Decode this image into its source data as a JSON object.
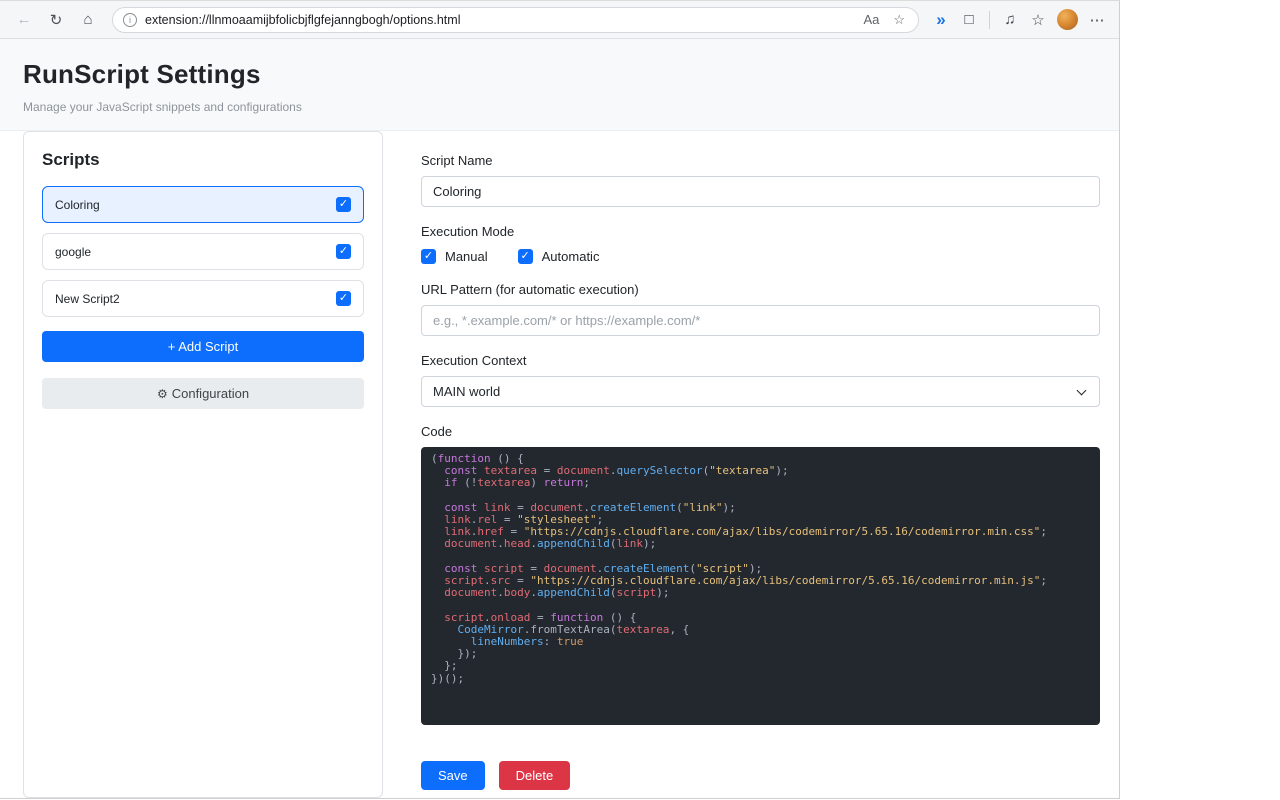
{
  "colors": {
    "accent": "#0d6efd",
    "danger": "#dc3545",
    "selected_bg": "#e7f1ff",
    "code_bg": "#23272e",
    "tok_plain": "#abb2bf",
    "tok_keyword": "#c678dd",
    "tok_variable": "#e06c75",
    "tok_function": "#61afef",
    "tok_string": "#e5c07b",
    "tok_literal": "#d19a66"
  },
  "browser": {
    "url": "extension://llnmoaamijbfolicbjflgfejanngbogh/options.html",
    "icons": {
      "back": "←",
      "refresh": "↻",
      "home": "⌂",
      "info": "i",
      "translate": "Aa",
      "favorite": "☆",
      "sidebar": "»",
      "collections": "□",
      "ext1": "♫",
      "ext2": "☆",
      "menu": "⋯"
    }
  },
  "page": {
    "title": "RunScript Settings",
    "subtitle": "Manage your JavaScript snippets and configurations"
  },
  "sidebar": {
    "heading": "Scripts",
    "scripts": [
      {
        "name": "Coloring",
        "checked": true,
        "selected": true
      },
      {
        "name": "google",
        "checked": true,
        "selected": false
      },
      {
        "name": "New Script2",
        "checked": true,
        "selected": false
      }
    ],
    "add_button": "+ Add Script",
    "config_icon": "⚙",
    "config_label": "Configuration"
  },
  "form": {
    "script_name": {
      "label": "Script Name",
      "value": "Coloring"
    },
    "execution_mode": {
      "label": "Execution Mode",
      "options": [
        {
          "label": "Manual",
          "checked": true
        },
        {
          "label": "Automatic",
          "checked": true
        }
      ]
    },
    "url_pattern": {
      "label": "URL Pattern (for automatic execution)",
      "value": "",
      "placeholder": "e.g., *.example.com/* or https://example.com/*"
    },
    "execution_context": {
      "label": "Execution Context",
      "value": "MAIN world"
    },
    "code": {
      "label": "Code",
      "lines": [
        [
          [
            "p",
            "("
          ],
          [
            "k",
            "function"
          ],
          [
            "p",
            " () {"
          ]
        ],
        [
          [
            "p",
            "  "
          ],
          [
            "k",
            "const"
          ],
          [
            "p",
            " "
          ],
          [
            "v",
            "textarea"
          ],
          [
            "p",
            " = "
          ],
          [
            "v",
            "document"
          ],
          [
            "p",
            "."
          ],
          [
            "f",
            "querySelector"
          ],
          [
            "p",
            "("
          ],
          [
            "s",
            "\"textarea\""
          ],
          [
            "p",
            ");"
          ]
        ],
        [
          [
            "p",
            "  "
          ],
          [
            "k",
            "if"
          ],
          [
            "p",
            " (!"
          ],
          [
            "v",
            "textarea"
          ],
          [
            "p",
            ") "
          ],
          [
            "k",
            "return"
          ],
          [
            "p",
            ";"
          ]
        ],
        [],
        [
          [
            "p",
            "  "
          ],
          [
            "k",
            "const"
          ],
          [
            "p",
            " "
          ],
          [
            "v",
            "link"
          ],
          [
            "p",
            " = "
          ],
          [
            "v",
            "document"
          ],
          [
            "p",
            "."
          ],
          [
            "f",
            "createElement"
          ],
          [
            "p",
            "("
          ],
          [
            "s",
            "\"link\""
          ],
          [
            "p",
            ");"
          ]
        ],
        [
          [
            "p",
            "  "
          ],
          [
            "v",
            "link"
          ],
          [
            "p",
            "."
          ],
          [
            "v",
            "rel"
          ],
          [
            "p",
            " = "
          ],
          [
            "s",
            "\"stylesheet\""
          ],
          [
            "p",
            ";"
          ]
        ],
        [
          [
            "p",
            "  "
          ],
          [
            "v",
            "link"
          ],
          [
            "p",
            "."
          ],
          [
            "v",
            "href"
          ],
          [
            "p",
            " = "
          ],
          [
            "s",
            "\"https://cdnjs.cloudflare.com/ajax/libs/codemirror/5.65.16/codemirror.min.css\""
          ],
          [
            "p",
            ";"
          ]
        ],
        [
          [
            "p",
            "  "
          ],
          [
            "v",
            "document"
          ],
          [
            "p",
            "."
          ],
          [
            "v",
            "head"
          ],
          [
            "p",
            "."
          ],
          [
            "f",
            "appendChild"
          ],
          [
            "p",
            "("
          ],
          [
            "v",
            "link"
          ],
          [
            "p",
            ");"
          ]
        ],
        [],
        [
          [
            "p",
            "  "
          ],
          [
            "k",
            "const"
          ],
          [
            "p",
            " "
          ],
          [
            "v",
            "script"
          ],
          [
            "p",
            " = "
          ],
          [
            "v",
            "document"
          ],
          [
            "p",
            "."
          ],
          [
            "f",
            "createElement"
          ],
          [
            "p",
            "("
          ],
          [
            "s",
            "\"script\""
          ],
          [
            "p",
            ");"
          ]
        ],
        [
          [
            "p",
            "  "
          ],
          [
            "v",
            "script"
          ],
          [
            "p",
            "."
          ],
          [
            "v",
            "src"
          ],
          [
            "p",
            " = "
          ],
          [
            "s",
            "\"https://cdnjs.cloudflare.com/ajax/libs/codemirror/5.65.16/codemirror.min.js\""
          ],
          [
            "p",
            ";"
          ]
        ],
        [
          [
            "p",
            "  "
          ],
          [
            "v",
            "document"
          ],
          [
            "p",
            "."
          ],
          [
            "v",
            "body"
          ],
          [
            "p",
            "."
          ],
          [
            "f",
            "appendChild"
          ],
          [
            "p",
            "("
          ],
          [
            "v",
            "script"
          ],
          [
            "p",
            ");"
          ]
        ],
        [],
        [
          [
            "p",
            "  "
          ],
          [
            "v",
            "script"
          ],
          [
            "p",
            "."
          ],
          [
            "v",
            "onload"
          ],
          [
            "p",
            " = "
          ],
          [
            "k",
            "function"
          ],
          [
            "p",
            " () {"
          ]
        ],
        [
          [
            "p",
            "    "
          ],
          [
            "f",
            "CodeMirror"
          ],
          [
            "p",
            ".fromTextArea("
          ],
          [
            "v",
            "textarea"
          ],
          [
            "p",
            ", {"
          ]
        ],
        [
          [
            "p",
            "      "
          ],
          [
            "f",
            "lineNumbers"
          ],
          [
            "p",
            ": "
          ],
          [
            "l",
            "true"
          ]
        ],
        [
          [
            "p",
            "    });"
          ]
        ],
        [
          [
            "p",
            "  };"
          ]
        ],
        [
          [
            "p",
            "})();"
          ]
        ]
      ]
    },
    "save_button": "Save",
    "delete_button": "Delete"
  }
}
